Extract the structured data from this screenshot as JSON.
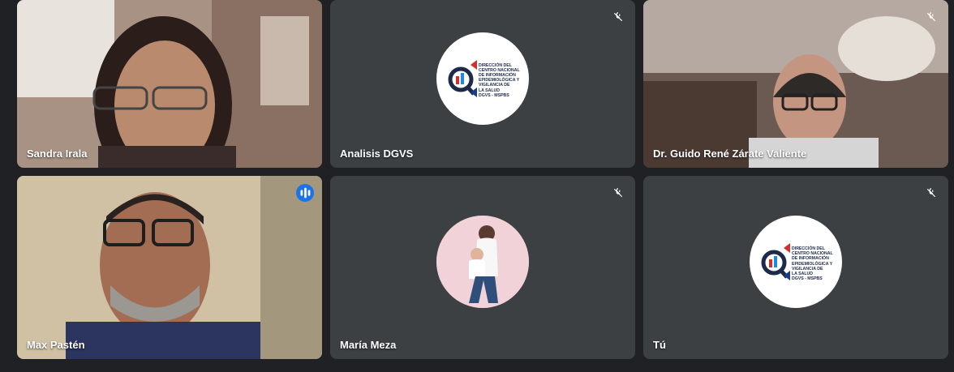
{
  "participants": [
    {
      "name": "Sandra Irala",
      "type": "video",
      "muted": false
    },
    {
      "name": "Analisis DGVS",
      "type": "logo",
      "muted": true
    },
    {
      "name": "Dr. Guido René Zárate Valiente",
      "type": "video",
      "muted": true
    },
    {
      "name": "Max Pastén",
      "type": "video",
      "muted": false,
      "speaking": true
    },
    {
      "name": "María Meza",
      "type": "photo",
      "muted": true
    },
    {
      "name": "Tú",
      "type": "logo",
      "muted": true
    }
  ],
  "logo": {
    "lines": [
      "DIRECCIÓN DEL",
      "CENTRO NACIONAL",
      "DE INFORMACIÓN",
      "EPIDEMIOLÓGICA Y",
      "VIGILANCIA DE",
      "LA SALUD",
      "DGVS - MSPBS"
    ]
  },
  "colors": {
    "background": "#202124",
    "tile": "#3c4043",
    "active_outline": "#8ab4f8",
    "speaking": "#1a73e8"
  }
}
